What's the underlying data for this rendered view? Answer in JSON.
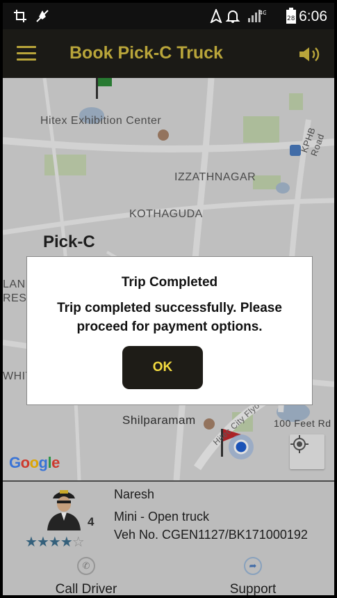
{
  "status_bar": {
    "time": "6:06",
    "network": "4G",
    "battery": "28"
  },
  "app_bar": {
    "title": "Book Pick-C Truck"
  },
  "map": {
    "labels": {
      "hitex": "Hitex Exhibition Center",
      "izzathnagar": "IZZATHNAGAR",
      "kothaguda": "KOTHAGUDA",
      "pickc": "Pick-C",
      "kphb": "KPHB Road",
      "shilparamam": "Shilparamam",
      "hitec_flyover": "Hitec City Flyo",
      "feet_rd": "100 Feet Rd",
      "land": "LAND",
      "resi": "RESI",
      "whit": "WHIT"
    },
    "attribution": "Google"
  },
  "dialog": {
    "title": "Trip Completed",
    "message": "Trip completed successfully. Please proceed for payment options.",
    "ok_label": "OK"
  },
  "driver": {
    "name": "Naresh",
    "rating_count": "4",
    "rating": 4,
    "rating_max": 5,
    "vehicle_type": "Mini - Open truck",
    "vehicle_no": "Veh No. CGEN1127/BK171000192"
  },
  "actions": {
    "call_label": "Call Driver",
    "support_label": "Support"
  },
  "colors": {
    "accent": "#b9a53a",
    "ok_text": "#f4dc40",
    "dark": "#1e1c17"
  }
}
